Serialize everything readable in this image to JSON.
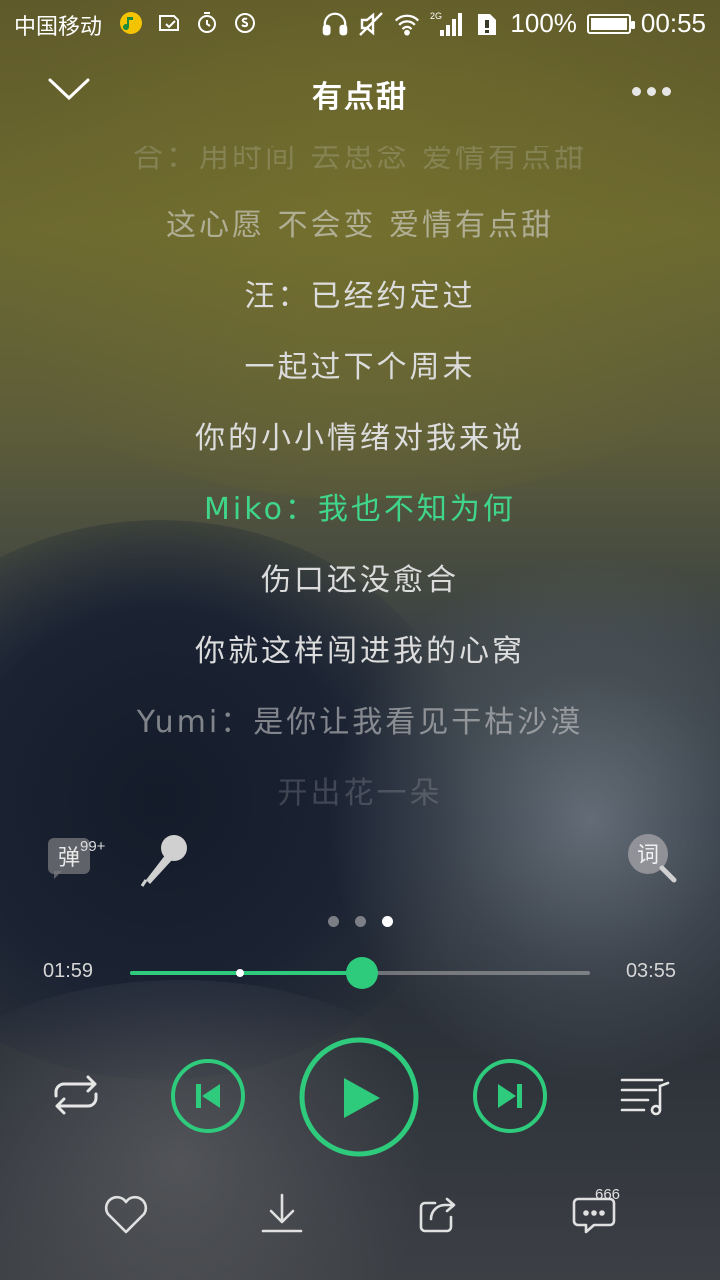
{
  "status_bar": {
    "carrier": "中国移动",
    "network": "2G",
    "battery": "100%",
    "time": "00:55"
  },
  "header": {
    "title": "有点甜"
  },
  "lyrics": {
    "lines": [
      {
        "text": "合：用时间 去思念 爱情有点甜",
        "state": "faded-top"
      },
      {
        "text": "这心愿 不会变 爱情有点甜",
        "state": "dim"
      },
      {
        "text": "汪：已经约定过",
        "state": "normal"
      },
      {
        "text": "一起过下个周末",
        "state": "normal"
      },
      {
        "text": "你的小小情绪对我来说",
        "state": "normal"
      },
      {
        "text": "Miko：我也不知为何",
        "state": "current"
      },
      {
        "text": "伤口还没愈合",
        "state": "normal"
      },
      {
        "text": "你就这样闯进我的心窝",
        "state": "normal"
      },
      {
        "text": "Yumi：是你让我看见干枯沙漠",
        "state": "dim"
      },
      {
        "text": "开出花一朵",
        "state": "faded-bottom"
      }
    ]
  },
  "tools": {
    "danmu_label": "弹",
    "danmu_count": "99+"
  },
  "pager": {
    "count": 3,
    "active_index": 2
  },
  "progress": {
    "current": "01:59",
    "duration": "03:55",
    "played_fraction": 0.505,
    "buffer_marker_fraction": 0.24
  },
  "bottom": {
    "comment_count": "666"
  },
  "colors": {
    "accent": "#2fcb7d",
    "lyric_current": "#3fd68a",
    "lyric_normal": "#dcdcdc"
  }
}
